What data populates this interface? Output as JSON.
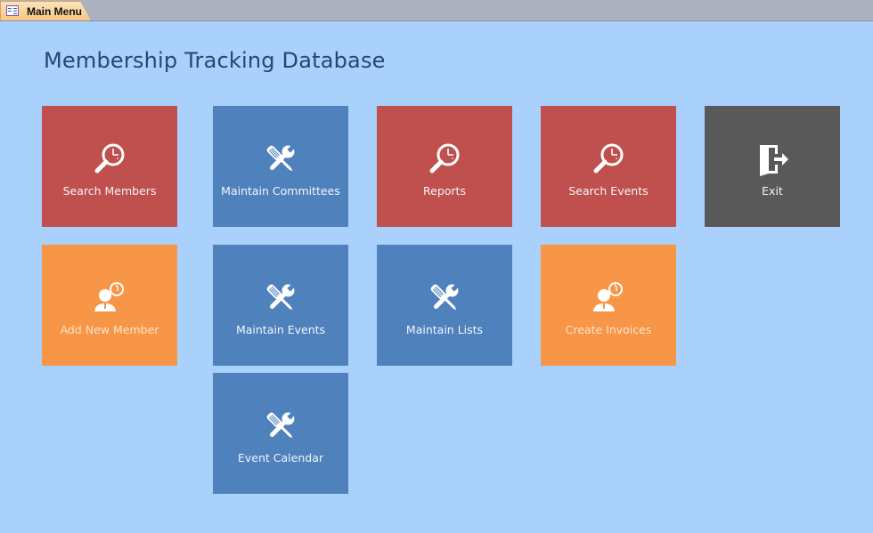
{
  "tabbar": {
    "active_tab": {
      "label": "Main Menu",
      "icon": "form-icon"
    }
  },
  "page": {
    "title": "Membership Tracking Database"
  },
  "tiles": [
    {
      "id": "search-members",
      "label": "Search Members",
      "icon": "search-clock-icon",
      "color": "#c0504d"
    },
    {
      "id": "maintain-committees",
      "label": "Maintain Committees",
      "icon": "tools-icon",
      "color": "#4f81bd"
    },
    {
      "id": "reports",
      "label": "Reports",
      "icon": "search-clock-icon",
      "color": "#c0504d"
    },
    {
      "id": "search-events",
      "label": "Search Events",
      "icon": "search-clock-icon",
      "color": "#c0504d"
    },
    {
      "id": "exit",
      "label": "Exit",
      "icon": "exit-door-icon",
      "color": "#595959"
    },
    {
      "id": "add-new-member",
      "label": "Add New Member",
      "icon": "user-clock-icon",
      "color": "#f79646"
    },
    {
      "id": "maintain-events",
      "label": "Maintain Events",
      "icon": "tools-icon",
      "color": "#4f81bd"
    },
    {
      "id": "maintain-lists",
      "label": "Maintain Lists",
      "icon": "tools-icon",
      "color": "#4f81bd"
    },
    {
      "id": "create-invoices",
      "label": "Create Invoices",
      "icon": "user-clock-icon",
      "color": "#f79646"
    },
    {
      "id": "event-calendar",
      "label": "Event Calendar",
      "icon": "tools-icon",
      "color": "#4f81bd"
    }
  ]
}
